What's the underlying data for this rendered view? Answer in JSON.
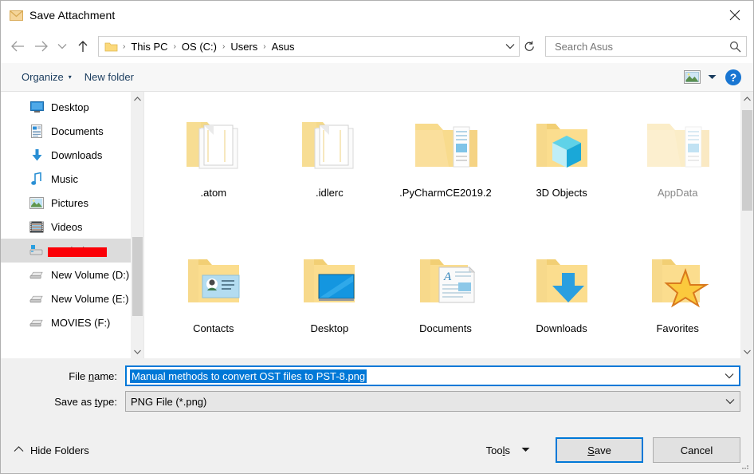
{
  "window": {
    "title": "Save Attachment",
    "icon": "mail-envelope-icon",
    "close_label": "✕"
  },
  "addressbar": {
    "back_icon": "←",
    "forward_icon": "→",
    "recent_icon": "∨",
    "up_icon": "↑",
    "breadcrumbs": [
      "This PC",
      "OS (C:)",
      "Users",
      "Asus"
    ],
    "separator": "›",
    "dropdown_icon": "∨",
    "refresh_icon": "↻",
    "search": {
      "placeholder": "Search Asus",
      "value": "",
      "icon": "search-icon"
    }
  },
  "toolbar": {
    "organize_label": "Organize",
    "organize_caret": "▾",
    "new_folder_label": "New folder",
    "view_caret": "▾",
    "help_label": "?"
  },
  "sidebar": {
    "scroll_up": "⌃",
    "scroll_down": "⌄",
    "items": [
      {
        "label": "Desktop",
        "icon": "desktop-icon",
        "selected": false,
        "redacted": false
      },
      {
        "label": "Documents",
        "icon": "documents-icon",
        "selected": false,
        "redacted": false
      },
      {
        "label": "Downloads",
        "icon": "downloads-icon",
        "selected": false,
        "redacted": false
      },
      {
        "label": "Music",
        "icon": "music-icon",
        "selected": false,
        "redacted": false
      },
      {
        "label": "Pictures",
        "icon": "pictures-icon",
        "selected": false,
        "redacted": false
      },
      {
        "label": "Videos",
        "icon": "videos-icon",
        "selected": false,
        "redacted": false
      },
      {
        "label": "OS (C:)",
        "icon": "harddrive-icon",
        "selected": true,
        "redacted": true
      },
      {
        "label": "New Volume (D:)",
        "icon": "drive-icon",
        "selected": false,
        "redacted": false
      },
      {
        "label": "New Volume (E:)",
        "icon": "drive-icon",
        "selected": false,
        "redacted": false
      },
      {
        "label": "MOVIES (F:)",
        "icon": "drive-icon",
        "selected": false,
        "redacted": false
      }
    ]
  },
  "filegrid": {
    "scroll_up": "⌃",
    "scroll_down": "⌄",
    "items": [
      {
        "label": ".atom",
        "icon": "folder-documents-icon",
        "faded": false
      },
      {
        "label": ".idlerc",
        "icon": "folder-documents-icon",
        "faded": false
      },
      {
        "label": ".PyCharmCE2019.2",
        "icon": "folder-files-icon",
        "faded": false
      },
      {
        "label": "3D Objects",
        "icon": "folder-3dobjects-icon",
        "faded": false
      },
      {
        "label": "AppData",
        "icon": "folder-files-icon",
        "faded": true
      },
      {
        "label": "Contacts",
        "icon": "folder-contacts-icon",
        "faded": false
      },
      {
        "label": "Desktop",
        "icon": "folder-desktop-icon",
        "faded": false
      },
      {
        "label": "Documents",
        "icon": "folder-documents2-icon",
        "faded": false
      },
      {
        "label": "Downloads",
        "icon": "folder-downloads-icon",
        "faded": false
      },
      {
        "label": "Favorites",
        "icon": "folder-favorites-icon",
        "faded": false
      }
    ]
  },
  "form": {
    "filename_label": "File name:",
    "filename_value": "Manual methods to convert OST files to PST-8.png",
    "filename_caret": "∨",
    "filetype_label": "Save as type:",
    "filetype_value": "PNG File (*.png)",
    "filetype_caret": "∨"
  },
  "footer": {
    "hide_folders_caret": "⌃",
    "hide_folders_label": "Hide Folders",
    "tools_label": "Tools",
    "tools_caret": "▼",
    "save_label": "Save",
    "cancel_label": "Cancel"
  },
  "colors": {
    "accent": "#0078d7",
    "folder_yellow": "#ffd976",
    "redaction_red": "#fb0007",
    "titlebar_bg": "#ffffff",
    "dialog_bg": "#f0f0f0"
  }
}
